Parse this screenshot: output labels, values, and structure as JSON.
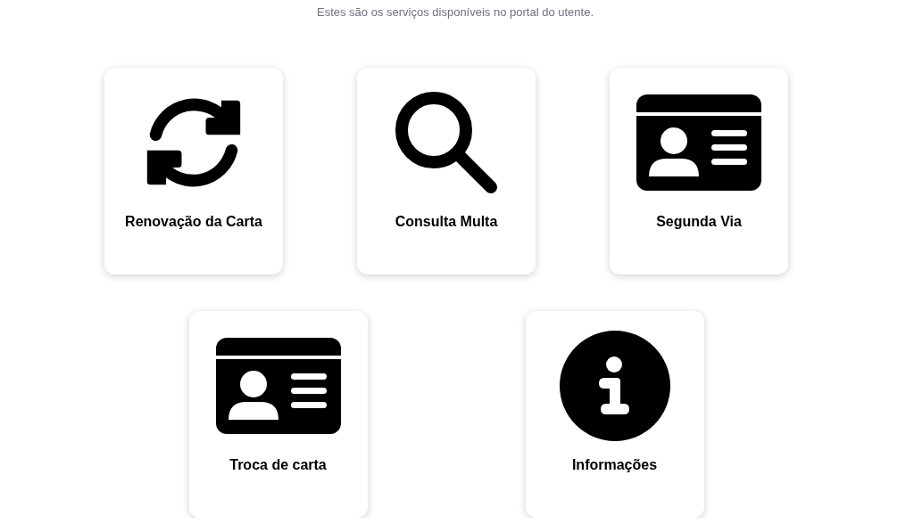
{
  "subtitle": "Estes são os serviços disponíveis no portal do utente.",
  "rows": [
    {
      "cards": [
        {
          "label": "Renovação da Carta",
          "kind": "refresh"
        },
        {
          "label": "Consulta Multa",
          "kind": "search"
        },
        {
          "label": "Segunda Via",
          "kind": "id-card"
        }
      ]
    },
    {
      "cards": [
        {
          "label": "Troca de carta",
          "kind": "id-card"
        },
        {
          "label": "Informações",
          "kind": "info"
        }
      ]
    }
  ]
}
